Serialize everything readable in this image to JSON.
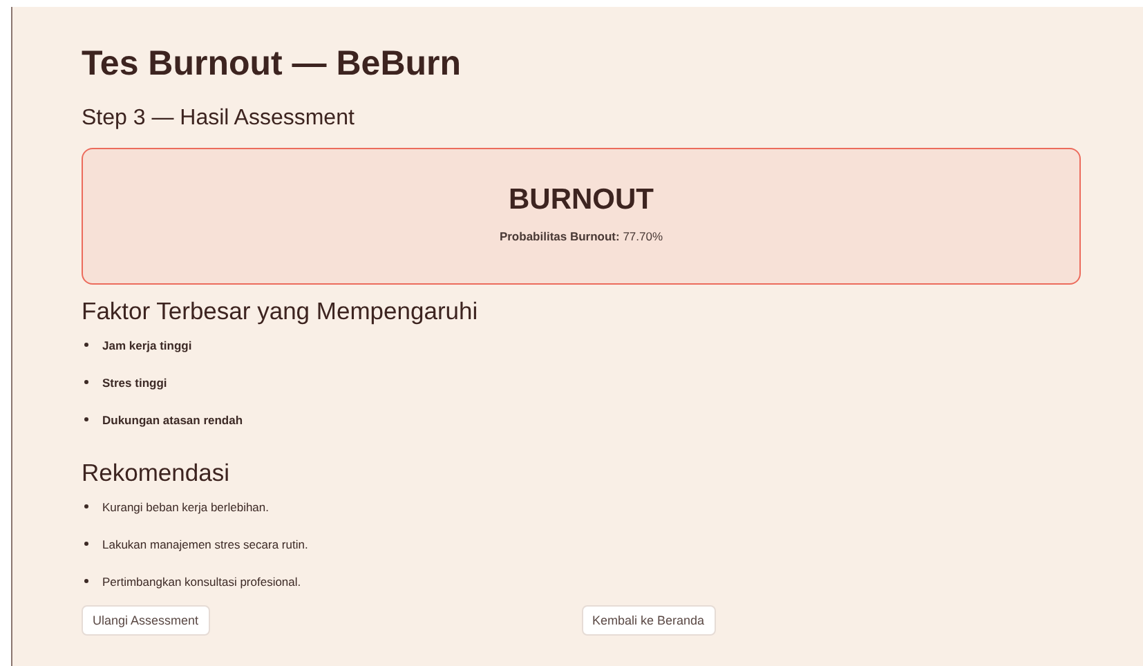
{
  "title": "Tes Burnout — BeBurn",
  "step": "Step 3 — Hasil Assessment",
  "result": {
    "label": "BURNOUT",
    "probability": "**Probabilitas Burnout:** 77.70%"
  },
  "factors": {
    "heading": "Faktor Terbesar yang Mempengaruhi",
    "items": [
      "Jam kerja tinggi",
      "Stres tinggi",
      "Dukungan atasan rendah"
    ]
  },
  "recommendations": {
    "heading": "Rekomendasi",
    "items": [
      "Kurangi beban kerja berlebihan.",
      "Lakukan manajemen stres secara rutin.",
      "Pertimbangkan konsultasi profesional."
    ]
  },
  "buttons": [
    "Ulangi Assessment",
    "Kembali ke Beranda"
  ]
}
